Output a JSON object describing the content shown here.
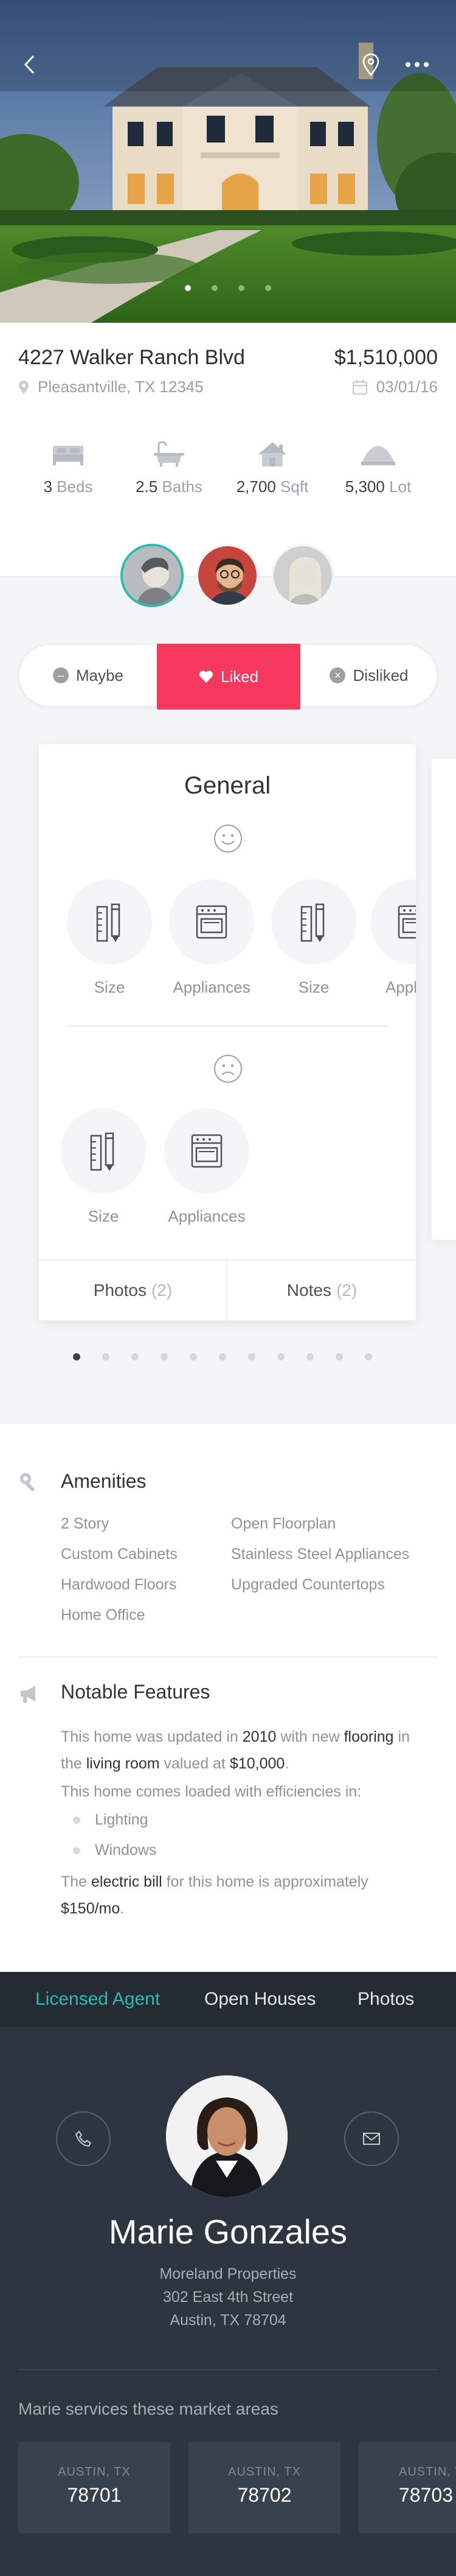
{
  "property": {
    "address": "4227 Walker Ranch Blvd",
    "price": "$1,510,000",
    "city": "Pleasantville, TX 12345",
    "date": "03/01/16"
  },
  "hero": {
    "slides_total": 4,
    "active_slide": 1
  },
  "stats": [
    {
      "icon": "bed-icon",
      "value": "3",
      "unit": "Beds"
    },
    {
      "icon": "bathtub-icon",
      "value": "2.5",
      "unit": "Baths"
    },
    {
      "icon": "house-icon",
      "value": "2,700",
      "unit": "Sqft"
    },
    {
      "icon": "lot-icon",
      "value": "5,300",
      "unit": "Lot"
    }
  ],
  "rating": {
    "maybe": "Maybe",
    "liked": "Liked",
    "disliked": "Disliked",
    "selected": "liked"
  },
  "card": {
    "title": "General",
    "liked_features": [
      {
        "icon": "ruler-pencil-icon",
        "label": "Size"
      },
      {
        "icon": "stove-icon",
        "label": "Appliances"
      },
      {
        "icon": "ruler-pencil-icon",
        "label": "Size"
      },
      {
        "icon": "stove-icon",
        "label": "Appli"
      }
    ],
    "disliked_features": [
      {
        "icon": "ruler-pencil-icon",
        "label": "Size"
      },
      {
        "icon": "stove-icon",
        "label": "Appliances"
      }
    ],
    "photos_label": "Photos",
    "photos_count": "(2)",
    "notes_label": "Notes",
    "notes_count": "(2)"
  },
  "pager": {
    "total": 11,
    "active": 1
  },
  "amenities": {
    "title": "Amenities",
    "left": [
      "2 Story",
      "Custom Cabinets",
      "Hardwood Floors",
      "Home Office"
    ],
    "right": [
      "Open Floorplan",
      "Stainless Steel Appliances",
      "Upgraded Countertops"
    ]
  },
  "notable": {
    "title": "Notable Features",
    "p1": {
      "a": "This home was updated in ",
      "year": "2010",
      "b": " with new ",
      "flooring": "flooring",
      "c": " in the ",
      "room": "living room",
      "d": " valued at ",
      "value": "$10,000",
      "e": "."
    },
    "p2": "This home comes loaded with efficiencies in:",
    "bullets": [
      "Lighting",
      "Windows"
    ],
    "p3": {
      "a": "The ",
      "bill": "electric bill",
      "b": " for this home is approximately ",
      "amount": "$150/mo",
      "c": "."
    }
  },
  "tabs": {
    "agent": "Licensed Agent",
    "open_houses": "Open Houses",
    "photos": "Photos",
    "active": "agent"
  },
  "agent": {
    "name": "Marie Gonzales",
    "company": "Moreland Properties",
    "street": "302 East 4th Street",
    "city": "Austin, TX 78704",
    "areas_title": "Marie services these market areas",
    "areas": [
      {
        "state": "AUSTIN, TX",
        "zip": "78701"
      },
      {
        "state": "AUSTIN, TX",
        "zip": "78702"
      },
      {
        "state": "AUSTIN, TX",
        "zip": "78703"
      }
    ]
  },
  "colors": {
    "accent_teal": "#2bbab0",
    "liked_pink": "#f6385f",
    "dark_bg": "#2d3640"
  }
}
